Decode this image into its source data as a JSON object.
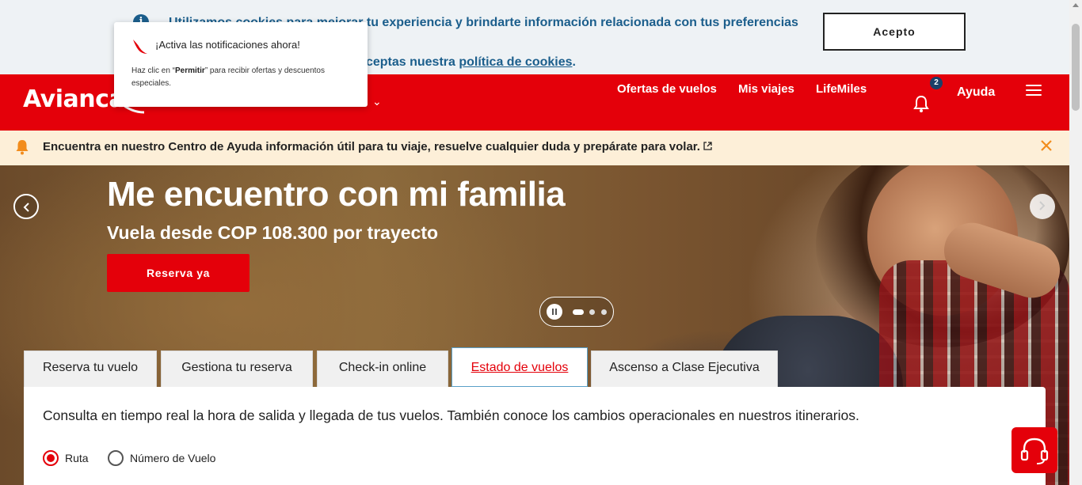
{
  "cookie": {
    "text_a": "Utilizamos cookies para mejorar tu experiencia y brindarte información relacionada con tus preferencias y",
    "text_b": "navegando, entenderemos que aceptas nuestra ",
    "link": "política de cookies",
    "text_end": ".",
    "accept_label": "Acepto"
  },
  "notification": {
    "title": "¡Activa las notificaciones ahora!",
    "body_pre": "Haz clic en “",
    "body_bold": "Permitir",
    "body_post": "” para recibir ofertas y descuentos especiales."
  },
  "header": {
    "logo": "Avianca",
    "nav": [
      "Ofertas de vuelos",
      "Mis viajes",
      "LifeMiles"
    ],
    "badge_count": "2",
    "help": "Ayuda"
  },
  "info_bar": {
    "text": "Encuentra en nuestro Centro de Ayuda información útil para tu viaje, resuelve cualquier duda y prepárate para volar."
  },
  "hero": {
    "title": "Me encuentro con mi familia",
    "subtitle": "Vuela desde COP 108.300 por trayecto",
    "cta": "Reserva ya",
    "slide_count": 3,
    "active_slide": 1
  },
  "tabs": [
    {
      "label": "Reserva tu vuelo"
    },
    {
      "label": "Gestiona tu reserva"
    },
    {
      "label": "Check-in online"
    },
    {
      "label": "Estado de vuelos"
    },
    {
      "label": "Ascenso a Clase Ejecutiva"
    }
  ],
  "panel": {
    "description": "Consulta en tiempo real la hora de salida y llegada de tus vuelos. También conoce los cambios operacionales en nuestros itinerarios.",
    "radio_route": "Ruta",
    "radio_flight": "Número de Vuelo"
  },
  "colors": {
    "brand_red": "#e4000a",
    "cookie_blue": "#1b5e8c",
    "info_bg": "#fdefd8"
  }
}
